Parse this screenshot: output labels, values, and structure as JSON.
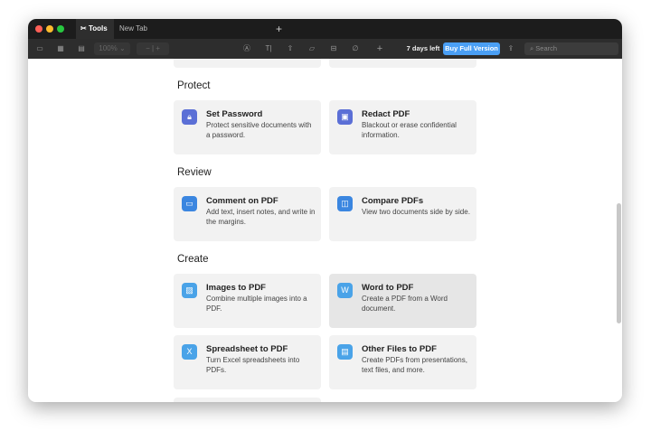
{
  "tabs": [
    {
      "label": "Tools",
      "icon": "tools-icon"
    },
    {
      "label": "New Tab"
    }
  ],
  "toolbar": {
    "zoom": "100%",
    "trial": "7 days left",
    "buy": "Buy Full Version",
    "search_placeholder": "Search",
    "accent": "#4a9ff5"
  },
  "sections": [
    {
      "title": "Protect",
      "cards": [
        {
          "title": "Set Password",
          "desc": "Protect sensitive documents with a password.",
          "icon": "lock-icon",
          "color": "#5b6fd6"
        },
        {
          "title": "Redact PDF",
          "desc": "Blackout or erase confidential information.",
          "icon": "redact-icon",
          "color": "#5b6fd6"
        }
      ]
    },
    {
      "title": "Review",
      "cards": [
        {
          "title": "Comment on PDF",
          "desc": "Add text, insert notes, and write in the margins.",
          "icon": "comment-icon",
          "color": "#3b86e0"
        },
        {
          "title": "Compare PDFs",
          "desc": "View two documents side by side.",
          "icon": "compare-icon",
          "color": "#3b86e0"
        }
      ]
    },
    {
      "title": "Create",
      "cards": [
        {
          "title": "Images to PDF",
          "desc": "Combine multiple images into a PDF.",
          "icon": "image-icon",
          "color": "#4aa3e8"
        },
        {
          "title": "Word to PDF",
          "desc": "Create a PDF from a Word document.",
          "icon": "word-icon",
          "color": "#4aa3e8"
        },
        {
          "title": "Spreadsheet to PDF",
          "desc": "Turn Excel spreadsheets into PDFs.",
          "icon": "spreadsheet-icon",
          "color": "#4aa3e8"
        },
        {
          "title": "Other Files to PDF",
          "desc": "Create PDFs from presentations, text files, and more.",
          "icon": "file-icon",
          "color": "#4aa3e8"
        }
      ]
    }
  ]
}
